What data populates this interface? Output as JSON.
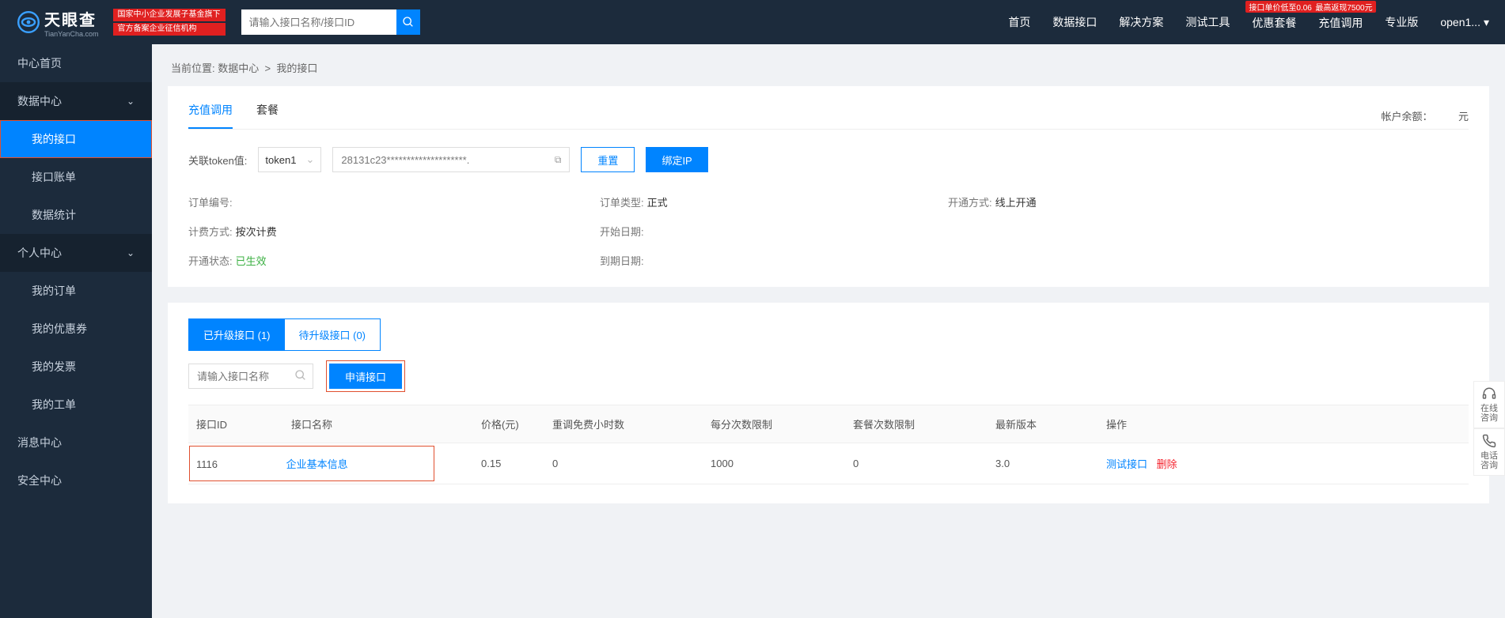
{
  "header": {
    "logo_cn": "天眼查",
    "logo_en": "TianYanCha.com",
    "badge1": "国家中小企业发展子基金旗下",
    "badge2": "官方备案企业征信机构",
    "search_placeholder": "请输入接口名称/接口ID",
    "nav": [
      "首页",
      "数据接口",
      "解决方案",
      "测试工具",
      "优惠套餐",
      "充值调用",
      "专业版"
    ],
    "nav_badge_discount": "接口单价低至0.06元",
    "nav_badge_cashback": "最高返现7500元",
    "user": "open1..."
  },
  "sidebar": {
    "home": "中心首页",
    "g1": "数据中心",
    "g1_items": [
      "我的接口",
      "接口账单",
      "数据统计"
    ],
    "g2": "个人中心",
    "g2_items": [
      "我的订单",
      "我的优惠券",
      "我的发票",
      "我的工单"
    ],
    "msg": "消息中心",
    "sec": "安全中心"
  },
  "breadcrumb": {
    "label": "当前位置:",
    "a": "数据中心",
    "sep": ">",
    "b": "我的接口"
  },
  "panel1": {
    "tabs": [
      "充值调用",
      "套餐"
    ],
    "balance_label": "帐户余额：",
    "balance_unit": "元",
    "token_label": "关联token值:",
    "token_select": "token1",
    "token_value": "28131c23********************.",
    "reset": "重置",
    "bind": "绑定IP",
    "info": {
      "order_no_k": "订单编号:",
      "order_no_v": "",
      "order_type_k": "订单类型:",
      "order_type_v": "正式",
      "open_mode_k": "开通方式:",
      "open_mode_v": "线上开通",
      "bill_k": "计费方式:",
      "bill_v": "按次计费",
      "start_k": "开始日期:",
      "start_v": "",
      "status_k": "开通状态:",
      "status_v": "已生效",
      "end_k": "到期日期:",
      "end_v": ""
    }
  },
  "panel2": {
    "tab_a": "已升级接口 (1)",
    "tab_b": "待升级接口 (0)",
    "search_placeholder": "请输入接口名称",
    "apply": "申请接口",
    "cols": [
      "接口ID",
      "接口名称",
      "价格(元)",
      "重调免费小时数",
      "每分次数限制",
      "套餐次数限制",
      "最新版本",
      "操作"
    ],
    "row": {
      "id": "1116",
      "name": "企业基本信息",
      "price": "0.15",
      "free_hours": "0",
      "per_min": "1000",
      "pkg_limit": "0",
      "version": "3.0",
      "test": "测试接口",
      "del": "删除"
    }
  },
  "float": {
    "chat": "在线咨询",
    "phone": "电话咨询"
  }
}
